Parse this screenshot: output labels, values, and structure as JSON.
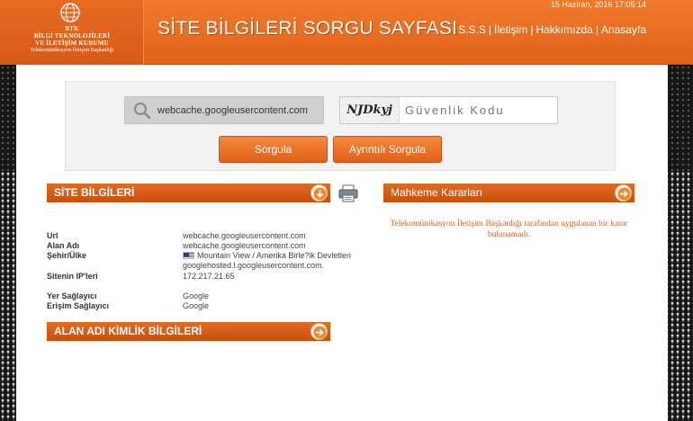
{
  "header": {
    "logo_lines": [
      "BTK",
      "BİLGİ TEKNOLOJİLERİ",
      "VE İLETİŞİM KURUMU"
    ],
    "logo_sub": "Telekomünikasyon İletişim Başkanlığı",
    "title": "SİTE BİLGİLERİ SORGU SAYFASI",
    "date": "15 Haziran, 2016 17:05:14",
    "nav": [
      {
        "label": "S.S.S"
      },
      {
        "label": "İletişim"
      },
      {
        "label": "Hakkımızda"
      },
      {
        "label": "Anasayfa"
      }
    ]
  },
  "search": {
    "value": "webcache.googleusercontent.com",
    "captcha_text": "NJDkyj",
    "captcha_placeholder": "Güvenlik Kodu",
    "btn_sorgula": "Sorgula",
    "btn_ayrintili": "Ayrıntılı Sorgula"
  },
  "site_info": {
    "title": "SİTE BİLGİLERİ",
    "rows": [
      {
        "label": "Url",
        "value": "webcache.googleusercontent.com"
      },
      {
        "label": "Alan Adı",
        "value": "webcache.googleusercontent.com"
      },
      {
        "label": "Şehir/Ülke",
        "value": "Mountain View / Amerika Birle?ik Devletleri"
      },
      {
        "label": "",
        "value": "googlehosted.l.googleusercontent.com."
      },
      {
        "label": "Sitenin IP'leri",
        "value": "172.217.21.65"
      },
      {
        "label": "Yer Sağlayıcı",
        "value": "Google"
      },
      {
        "label": "Erişim Sağlayıcı",
        "value": "Google"
      }
    ]
  },
  "mahkeme": {
    "title": "Mahkeme Kararları",
    "message": "Telekomünikasyon İletişim Başkanlığı tarafından uygulanan bir karar bulunamadı."
  },
  "alan_adi": {
    "title": "ALAN ADI KİMLİK BİLGİLERİ"
  },
  "colors": {
    "accent": "#e2621a",
    "message": "#d8622a"
  }
}
